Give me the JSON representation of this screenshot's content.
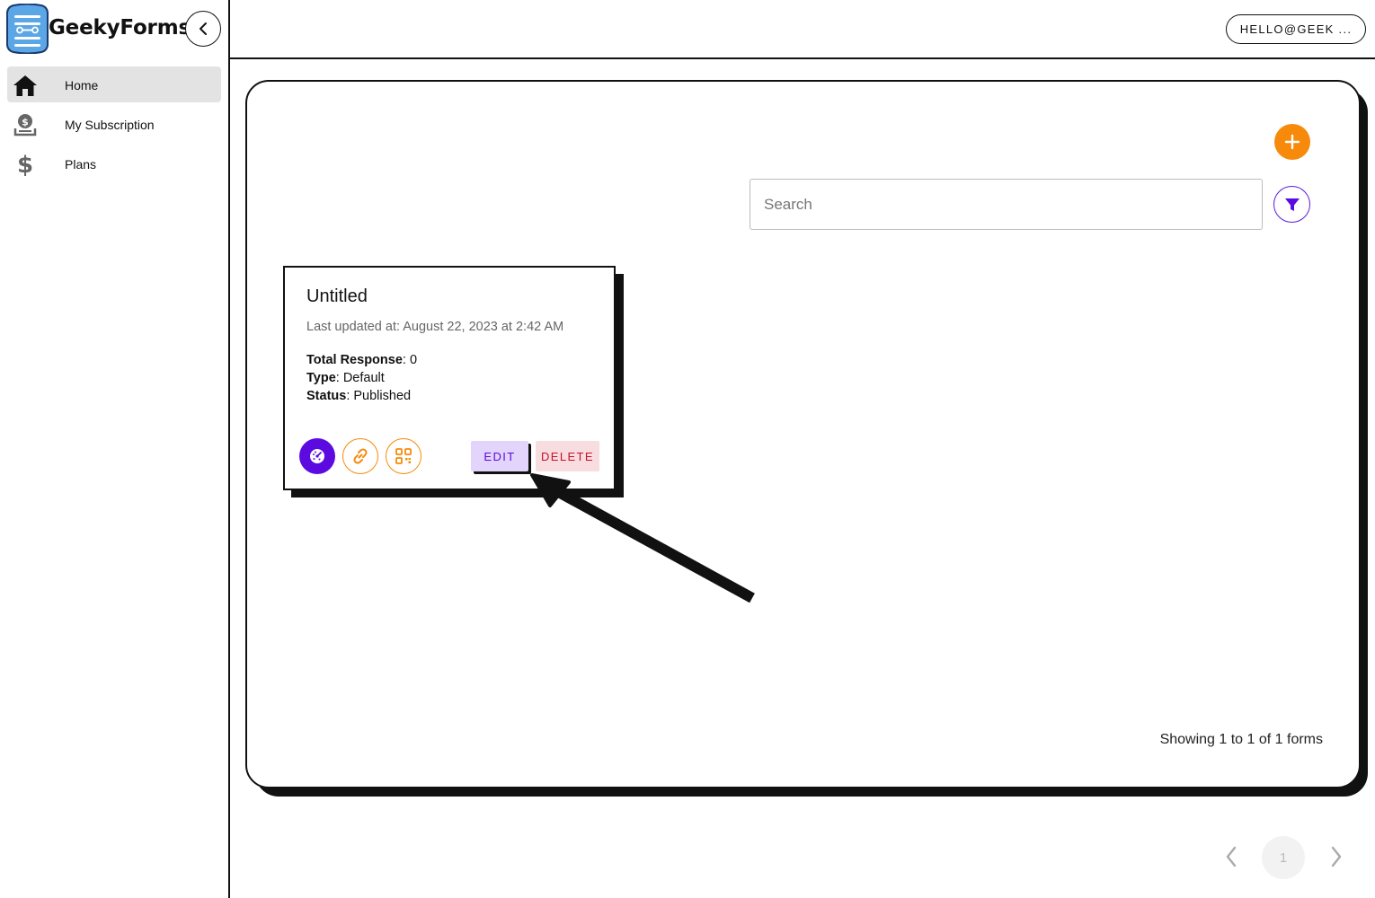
{
  "app": {
    "name": "GeekyForms"
  },
  "sidebar": {
    "items": [
      {
        "label": "Home",
        "icon": "home-icon",
        "active": true
      },
      {
        "label": "My Subscription",
        "icon": "subscription-icon",
        "active": false
      },
      {
        "label": "Plans",
        "icon": "dollar-icon",
        "active": false
      }
    ]
  },
  "header": {
    "user_label": "HELLO@GEEK ..."
  },
  "toolbar": {
    "search_placeholder": "Search"
  },
  "forms": [
    {
      "title": "Untitled",
      "updated": "Last updated at: August 22, 2023 at 2:42 AM",
      "total_response_label": "Total Response",
      "total_response_value": ": 0",
      "type_label": "Type",
      "type_value": ": Default",
      "status_label": "Status",
      "status_value": ": Published",
      "edit_label": "EDIT",
      "delete_label": "DELETE"
    }
  ],
  "footer": {
    "showing": "Showing 1 to 1 of 1 forms"
  },
  "pagination": {
    "current_page": "1"
  },
  "colors": {
    "accent_orange": "#f78a0b",
    "accent_purple": "#5b0be0",
    "delete_red": "#c8102e"
  }
}
